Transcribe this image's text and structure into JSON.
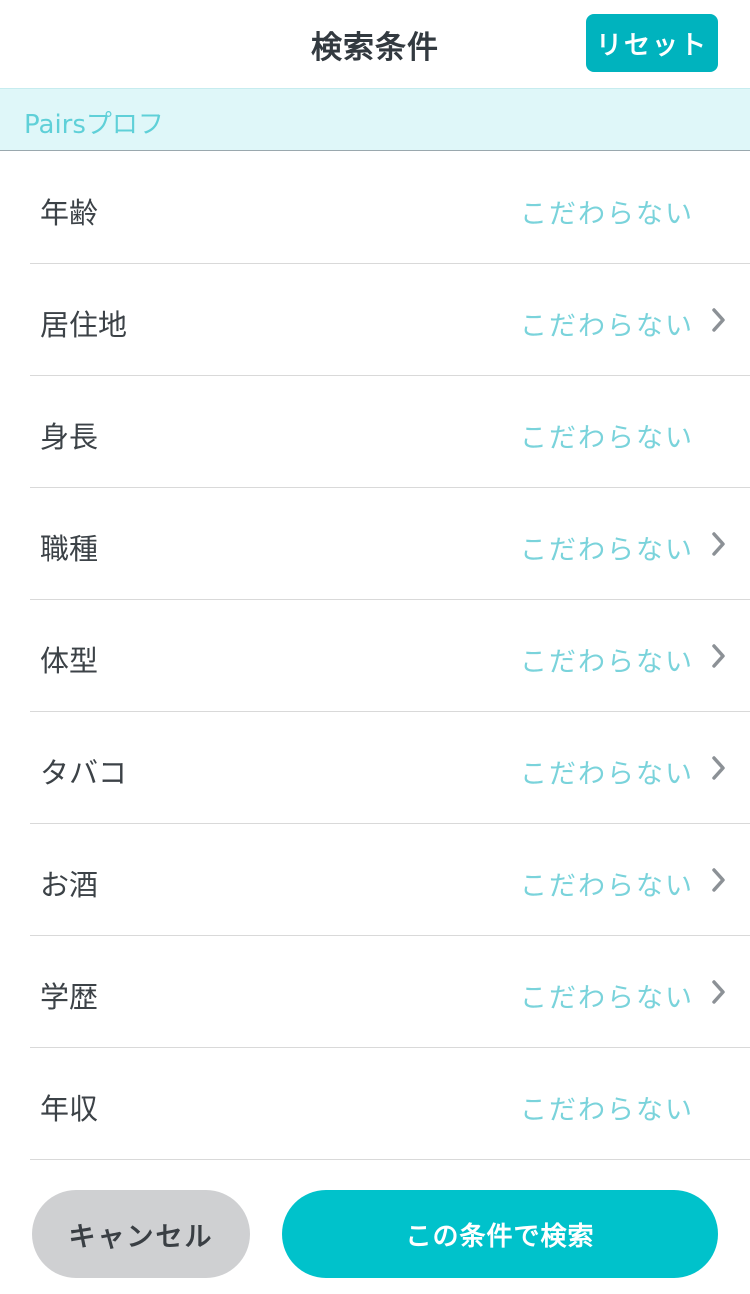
{
  "header": {
    "title": "検索条件",
    "reset_label": "リセット"
  },
  "section": {
    "label": "Pairsプロフ"
  },
  "rows": [
    {
      "label": "年齢",
      "value": "こだわらない",
      "has_chevron": false
    },
    {
      "label": "居住地",
      "value": "こだわらない",
      "has_chevron": true
    },
    {
      "label": "身長",
      "value": "こだわらない",
      "has_chevron": false
    },
    {
      "label": "職種",
      "value": "こだわらない",
      "has_chevron": true
    },
    {
      "label": "体型",
      "value": "こだわらない",
      "has_chevron": true
    },
    {
      "label": "タバコ",
      "value": "こだわらない",
      "has_chevron": true
    },
    {
      "label": "お酒",
      "value": "こだわらない",
      "has_chevron": true
    },
    {
      "label": "学歴",
      "value": "こだわらない",
      "has_chevron": true
    },
    {
      "label": "年収",
      "value": "こだわらない",
      "has_chevron": false
    }
  ],
  "footer": {
    "cancel_label": "キャンセル",
    "search_label": "この条件で検索"
  },
  "icons": {
    "chevron": "chevron-right-icon"
  },
  "colors": {
    "accent": "#00b3be",
    "search_button": "#00c2cb",
    "value_text": "#7ad3db",
    "section_bg": "#dff7f9"
  }
}
